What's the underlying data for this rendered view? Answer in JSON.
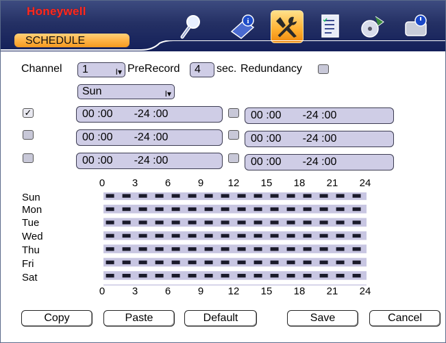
{
  "brand": "Honeywell",
  "tab_label": "SCHEDULE",
  "toolbar_icons": [
    {
      "name": "search-icon"
    },
    {
      "name": "info-icon"
    },
    {
      "name": "settings-tools-icon"
    },
    {
      "name": "checklist-icon"
    },
    {
      "name": "backup-icon"
    },
    {
      "name": "shutdown-icon"
    }
  ],
  "form": {
    "channel_label": "Channel",
    "channel_value": "1",
    "prerecord_label": "PreRecord",
    "prerecord_value": "4",
    "sec_label": "sec.",
    "redundancy_label": "Redundancy",
    "redundancy_checked": false,
    "day_value": "Sun"
  },
  "periods": [
    {
      "checked": true,
      "value": "00 :00       -24 :00"
    },
    {
      "checked": false,
      "value": "00 :00       -24 :00"
    },
    {
      "checked": false,
      "value": "00 :00       -24 :00"
    },
    {
      "checked": false,
      "value": "00 :00       -24 :00"
    },
    {
      "checked": false,
      "value": "00 :00       -24 :00"
    },
    {
      "checked": false,
      "value": "00 :00       -24 :00"
    }
  ],
  "timeline": {
    "hours": [
      "0",
      "3",
      "6",
      "9",
      "12",
      "15",
      "18",
      "21",
      "24"
    ],
    "days": [
      "Sun",
      "Mon",
      "Tue",
      "Wed",
      "Thu",
      "Fri",
      "Sat"
    ]
  },
  "buttons": {
    "copy": "Copy",
    "paste": "Paste",
    "default": "Default",
    "save": "Save",
    "cancel": "Cancel"
  },
  "colors": {
    "header_dark": "#14205a",
    "tab_orange": "#ffb347",
    "field_bg": "#cfcde6",
    "grid_stripe": "#c8c6e2",
    "brand_red": "#ff2a20"
  }
}
